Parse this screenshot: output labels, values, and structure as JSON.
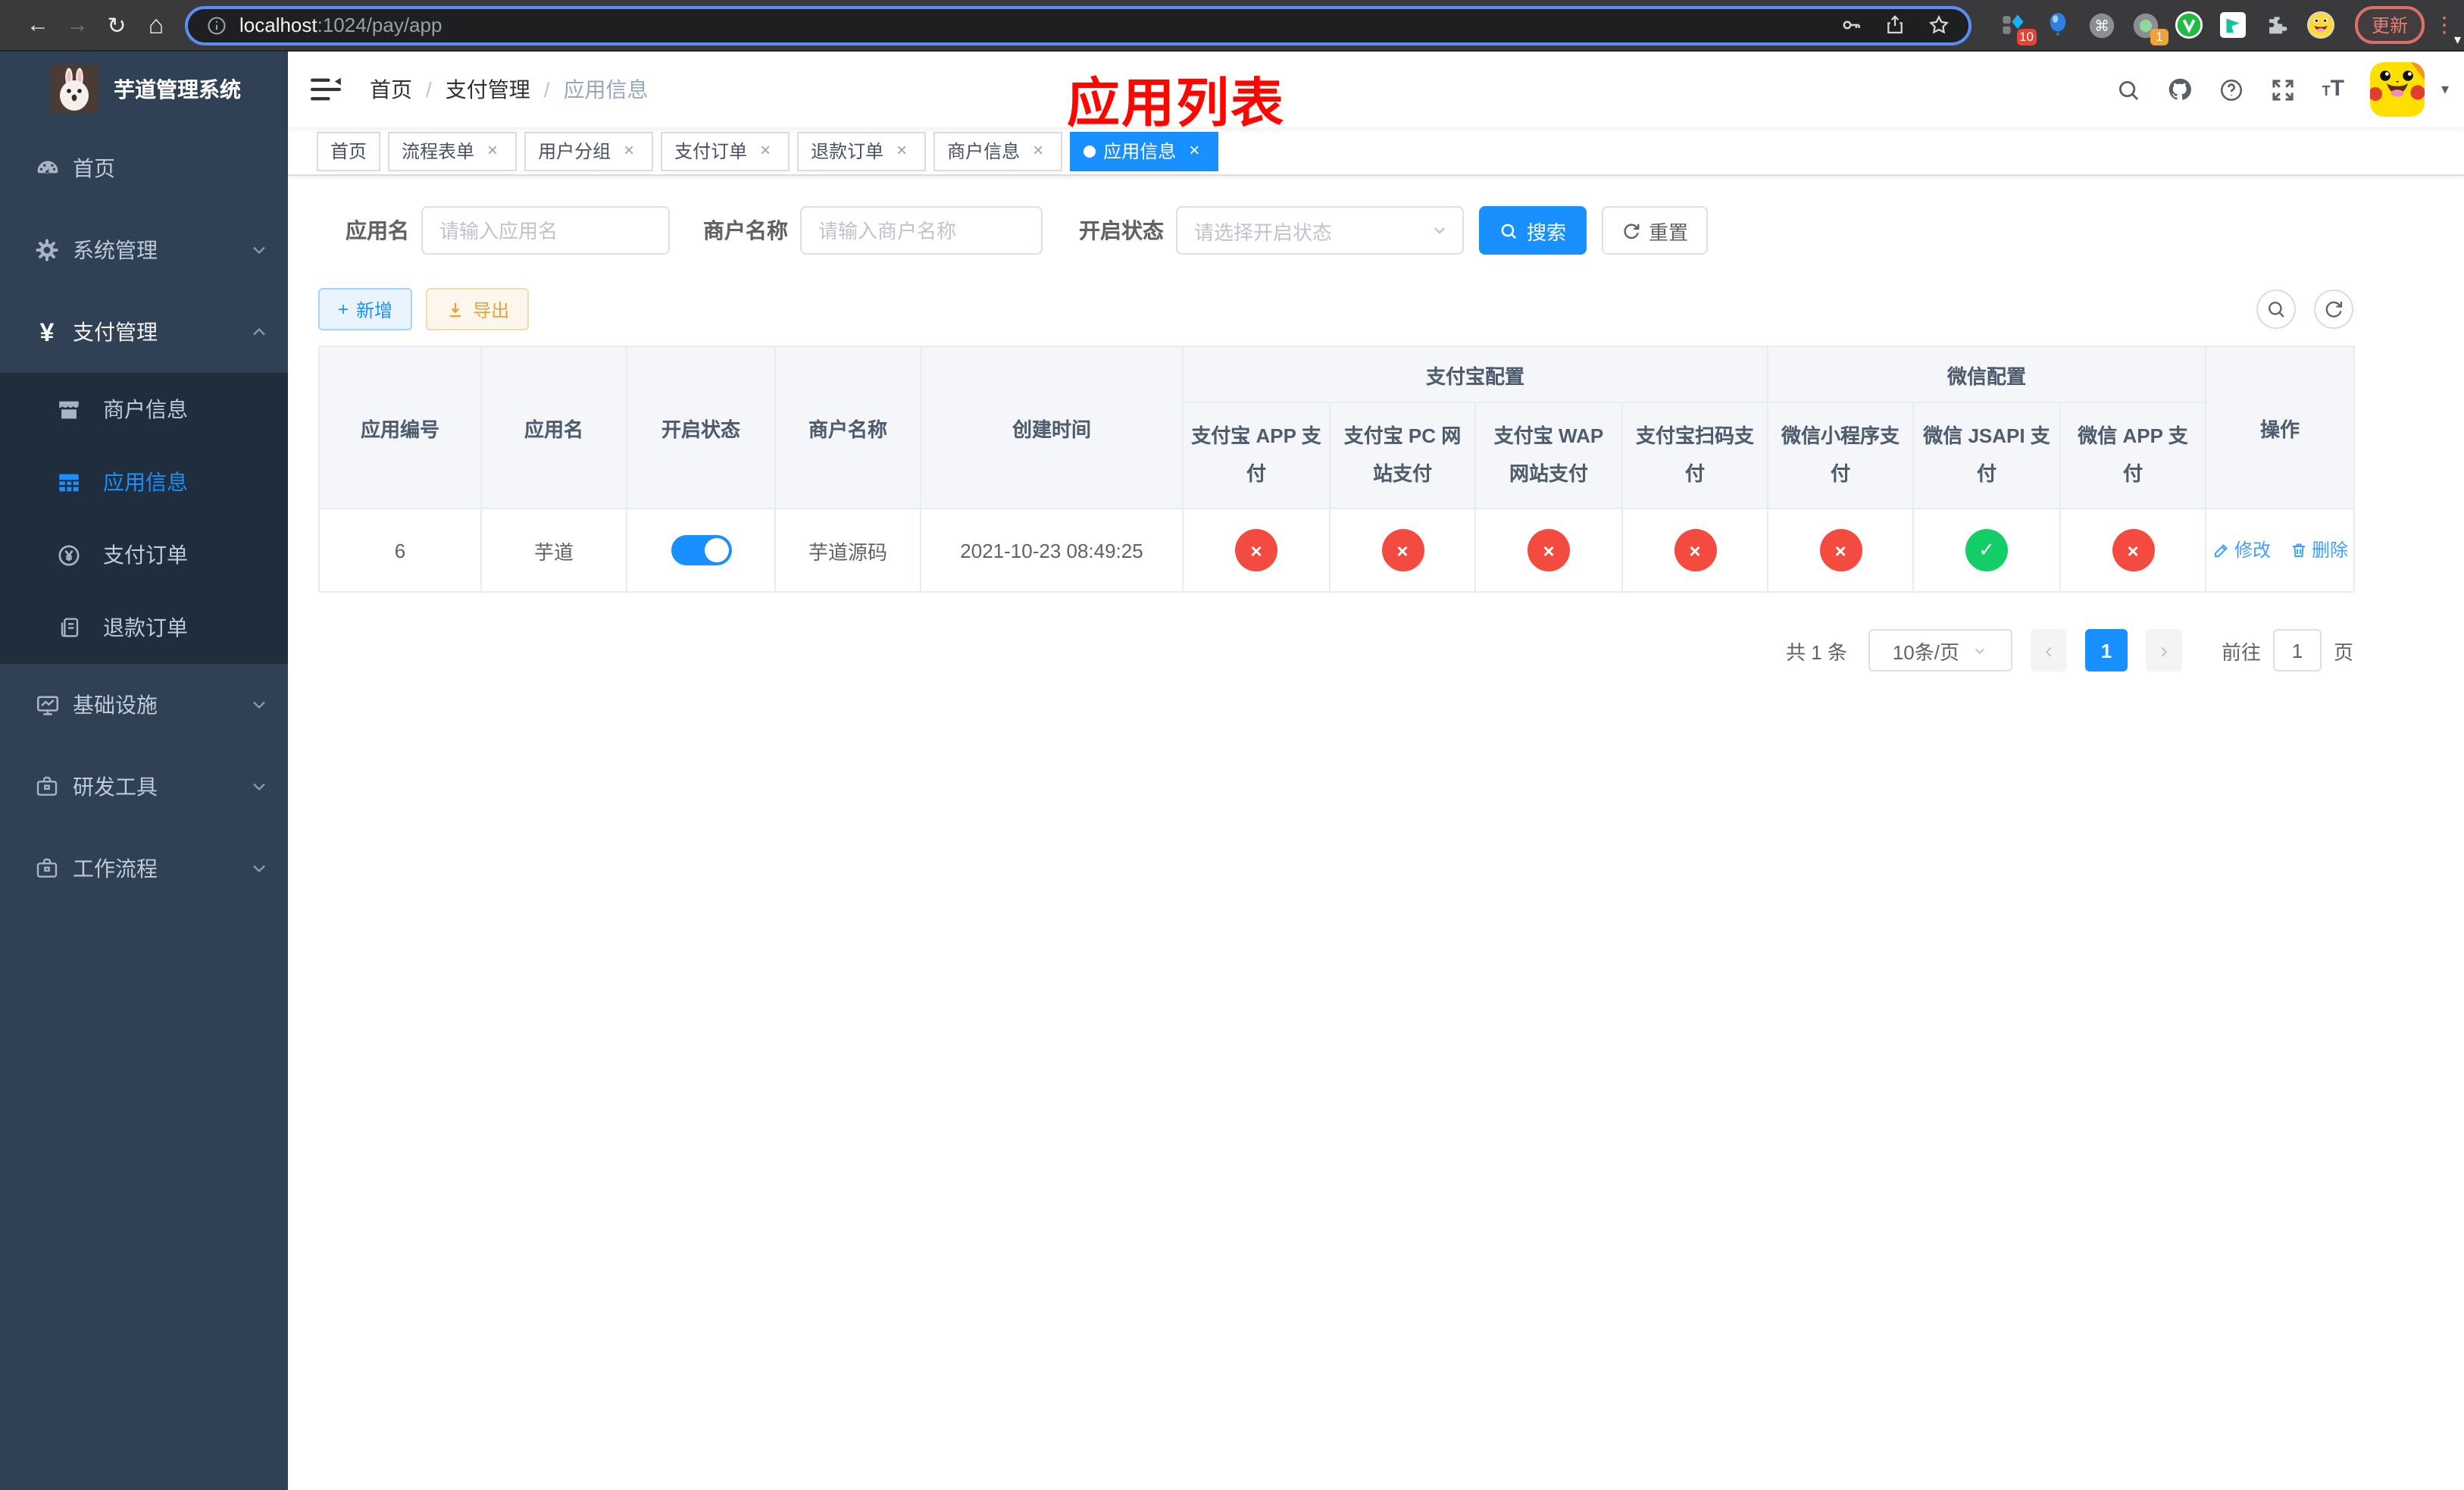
{
  "browser": {
    "host": "localhost",
    "path": ":1024/pay/app",
    "update_label": "更新",
    "ext_badge_tasks": "10",
    "ext_badge_session": "1"
  },
  "glyphs": {
    "back": "←",
    "forward": "→",
    "reload": "↻",
    "home": "⌂",
    "close": "×",
    "slash": "/",
    "prev": "‹",
    "next": "›",
    "dots_v": "⋮",
    "caret": "▾",
    "plus": "+",
    "yen": "¥",
    "check": "✓",
    "cross": "×",
    "cmd": "⌘",
    "small_t": "T",
    "big_t": "T"
  },
  "colors": {
    "primary": "#1890ff",
    "danger": "#f34b40",
    "success": "#13ce66",
    "warning": "#e6a23c",
    "sidebar_bg": "#304156",
    "submenu_bg": "#1f2d3d",
    "title_red": "#fe0600"
  },
  "sidebar": {
    "logo_title": "芋道管理系统",
    "items": [
      {
        "label": "首页"
      },
      {
        "label": "系统管理"
      },
      {
        "label": "支付管理"
      },
      {
        "label": "基础设施"
      },
      {
        "label": "研发工具"
      },
      {
        "label": "工作流程"
      }
    ],
    "payment_children": [
      {
        "label": "商户信息"
      },
      {
        "label": "应用信息"
      },
      {
        "label": "支付订单"
      },
      {
        "label": "退款订单"
      }
    ]
  },
  "nav": {
    "breadcrumb": [
      "首页",
      "支付管理",
      "应用信息"
    ],
    "page_title": "应用列表"
  },
  "tabs": [
    {
      "label": "首页",
      "closable": false,
      "active": false
    },
    {
      "label": "流程表单",
      "closable": true,
      "active": false
    },
    {
      "label": "用户分组",
      "closable": true,
      "active": false
    },
    {
      "label": "支付订单",
      "closable": true,
      "active": false
    },
    {
      "label": "退款订单",
      "closable": true,
      "active": false
    },
    {
      "label": "商户信息",
      "closable": true,
      "active": false
    },
    {
      "label": "应用信息",
      "closable": true,
      "active": true
    }
  ],
  "filters": {
    "app_name_label": "应用名",
    "app_name_placeholder": "请输入应用名",
    "merchant_label": "商户名称",
    "merchant_placeholder": "请输入商户名称",
    "status_label": "开启状态",
    "status_placeholder": "请选择开启状态",
    "search_label": "搜索",
    "reset_label": "重置"
  },
  "toolbar": {
    "add_label": "新增",
    "export_label": "导出"
  },
  "table": {
    "plain_columns": [
      "应用编号",
      "应用名",
      "开启状态",
      "商户名称",
      "创建时间"
    ],
    "alipay_group": "支付宝配置",
    "alipay_columns": [
      "支付宝 APP 支付",
      "支付宝 PC 网站支付",
      "支付宝 WAP 网站支付",
      "支付宝扫码支付"
    ],
    "wechat_group": "微信配置",
    "wechat_columns": [
      "微信小程序支付",
      "微信 JSAPI 支付",
      "微信 APP 支付"
    ],
    "action_column": "操作",
    "row": {
      "id": "6",
      "name": "芋道",
      "enabled": true,
      "merchant": "芋道源码",
      "created": "2021-10-23 08:49:25",
      "statuses": [
        "error",
        "error",
        "error",
        "error",
        "error",
        "success",
        "error"
      ],
      "edit_label": "修改",
      "delete_label": "删除"
    }
  },
  "pagination": {
    "total": "共 1 条",
    "per_page": "10条/页",
    "page": "1",
    "goto_label": "前往",
    "goto_value": "1",
    "page_suffix": "页"
  }
}
